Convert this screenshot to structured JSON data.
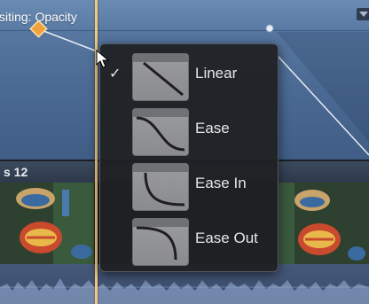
{
  "keyframe_editor": {
    "track_label": "siting: Opacity",
    "collapse_icon": "triangle-down-icon"
  },
  "clip": {
    "name": "s 12"
  },
  "curve_menu": {
    "items": [
      {
        "label": "Linear",
        "checked": true,
        "icon": "linear-curve-icon",
        "check": "✓"
      },
      {
        "label": "Ease",
        "checked": false,
        "icon": "ease-curve-icon",
        "check": ""
      },
      {
        "label": "Ease In",
        "checked": false,
        "icon": "ease-in-curve-icon",
        "check": ""
      },
      {
        "label": "Ease Out",
        "checked": false,
        "icon": "ease-out-curve-icon",
        "check": ""
      }
    ]
  },
  "colors": {
    "playhead": "#f3c879",
    "keyframe": "#f0a23c",
    "editor_blue": "#587aa3"
  }
}
